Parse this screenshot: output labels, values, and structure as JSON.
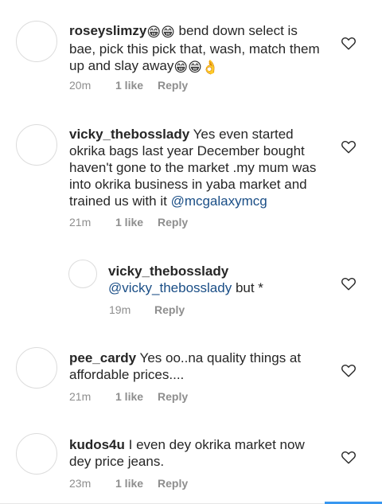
{
  "comments": [
    {
      "username": "roseyslimzy",
      "pre_emoji": "😁😁",
      "text": " bend down select is bae, pick this pick that, wash, match them up and slay away",
      "post_emoji": "😁😁👌",
      "time": "20m",
      "likes": "1 like",
      "reply": "Reply"
    },
    {
      "username": "vicky_thebosslady",
      "text": " Yes even started okrika bags last year December bought haven't gone to the market .my mum was into okrika business in yaba market and trained us with it ",
      "mention": "@mcgalaxymcg",
      "time": "21m",
      "likes": "1 like",
      "reply": "Reply"
    },
    {
      "username": "vicky_thebosslady",
      "mention": "@vicky_thebosslady",
      "text": " but *",
      "time": "19m",
      "reply": "Reply"
    },
    {
      "username": "pee_cardy",
      "text": " Yes oo..na quality things at affordable prices....",
      "time": "21m",
      "likes": "1 like",
      "reply": "Reply"
    },
    {
      "username": "kudos4u",
      "text": " I even dey okrika market now dey price jeans.",
      "time": "23m",
      "likes": "1 like",
      "reply": "Reply"
    }
  ],
  "icons": {
    "like": "heart-outline-icon"
  },
  "colors": {
    "mention": "#1a4e86",
    "meta": "#8e8e8e",
    "accent": "#3897f0"
  }
}
